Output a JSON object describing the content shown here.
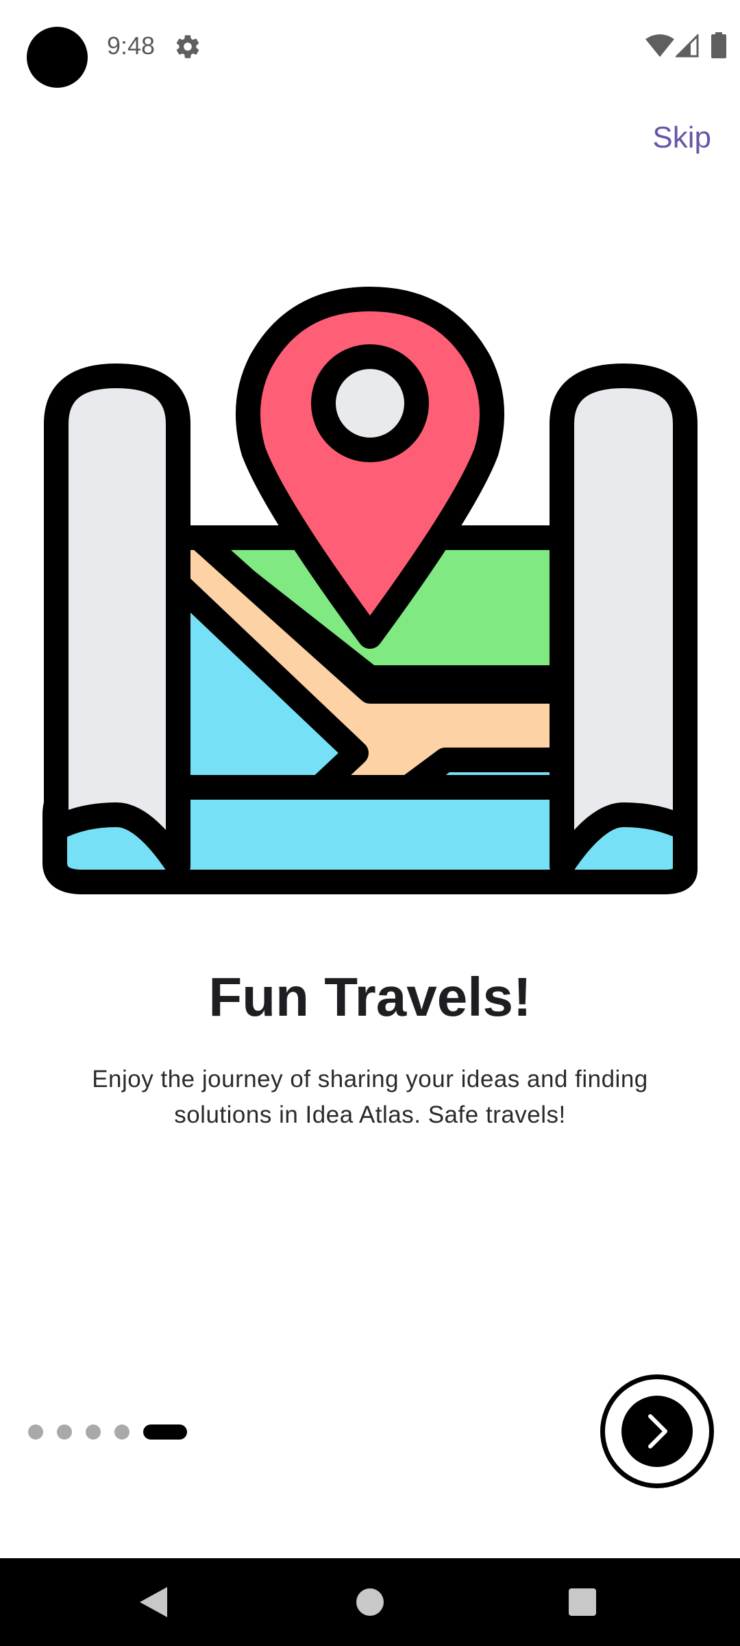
{
  "status_bar": {
    "time": "9:48",
    "icons": [
      "settings-icon",
      "wifi-icon",
      "signal-icon",
      "battery-icon"
    ]
  },
  "onboarding": {
    "skip_label": "Skip",
    "illustration": "map-with-location-pin-icon",
    "title": "Fun Travels!",
    "description_line1": "Enjoy the journey of sharing your ideas and finding",
    "description_line2": "solutions in Idea Atlas. Safe travels!",
    "page_count": 5,
    "current_page": 5,
    "next_icon": "chevron-right-icon"
  },
  "nav_bar": {
    "buttons": [
      "back-icon",
      "home-icon",
      "recents-icon"
    ]
  },
  "colors": {
    "accent": "#6a55a6",
    "pin": "#ff5f76",
    "map_green": "#80e981",
    "map_blue": "#76e1f6",
    "map_road": "#fdd3a6",
    "scroll_gray": "#e9eaee",
    "dot_inactive": "#a9a9a9",
    "dot_active": "#000000"
  }
}
